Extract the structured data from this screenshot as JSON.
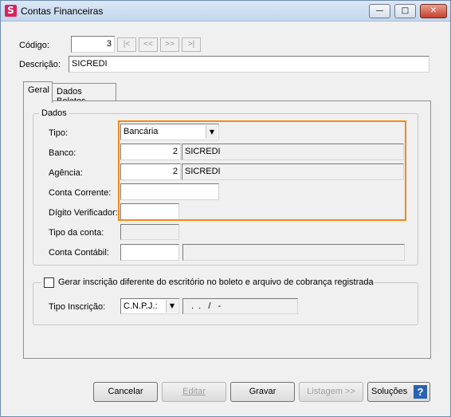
{
  "window": {
    "title": "Contas Financeiras",
    "app_icon_glyph": "S",
    "minimize_glyph": "—",
    "maximize_glyph": "□",
    "close_glyph": "✕"
  },
  "header": {
    "codigo_label": "Código:",
    "codigo_value": "3",
    "nav": {
      "first": "|<",
      "prev": "<<",
      "next": ">>",
      "last": ">|"
    },
    "descricao_label": "Descrição:",
    "descricao_value": "SICREDI"
  },
  "tabs": [
    {
      "label": "Geral",
      "active": true
    },
    {
      "label": "Dados Boletos",
      "active": false
    }
  ],
  "dados": {
    "group_title": "Dados",
    "tipo_label": "Tipo:",
    "tipo_value": "Bancária",
    "banco_label": "Banco:",
    "banco_code": "2",
    "banco_name": "SICREDI",
    "agencia_label": "Agência:",
    "agencia_code": "2",
    "agencia_name": "SICREDI",
    "conta_corrente_label": "Conta Corrente:",
    "conta_corrente_value": "",
    "digito_label": "Dígito Verificador:",
    "digito_value": "",
    "tipo_conta_label": "Tipo da conta:",
    "tipo_conta_value": "",
    "conta_contabil_label": "Conta Contábil:",
    "conta_contabil_code": "",
    "conta_contabil_name": ""
  },
  "inscricao": {
    "checkbox_label": "Gerar inscrição diferente do escritório no boleto e arquivo de cobrança registrada",
    "checked": false,
    "tipo_label": "Tipo Inscrição:",
    "tipo_value": "C.N.P.J.:",
    "number_mask": ".  .   /   -"
  },
  "buttons": {
    "cancelar": "Cancelar",
    "editar": "Editar",
    "gravar": "Gravar",
    "listagem": "Listagem >>",
    "solucoes": "Soluções",
    "help_glyph": "?"
  },
  "colors": {
    "highlight": "#f28a17",
    "help_icon": "#2b62b5",
    "app_icon": "#d8245e"
  }
}
